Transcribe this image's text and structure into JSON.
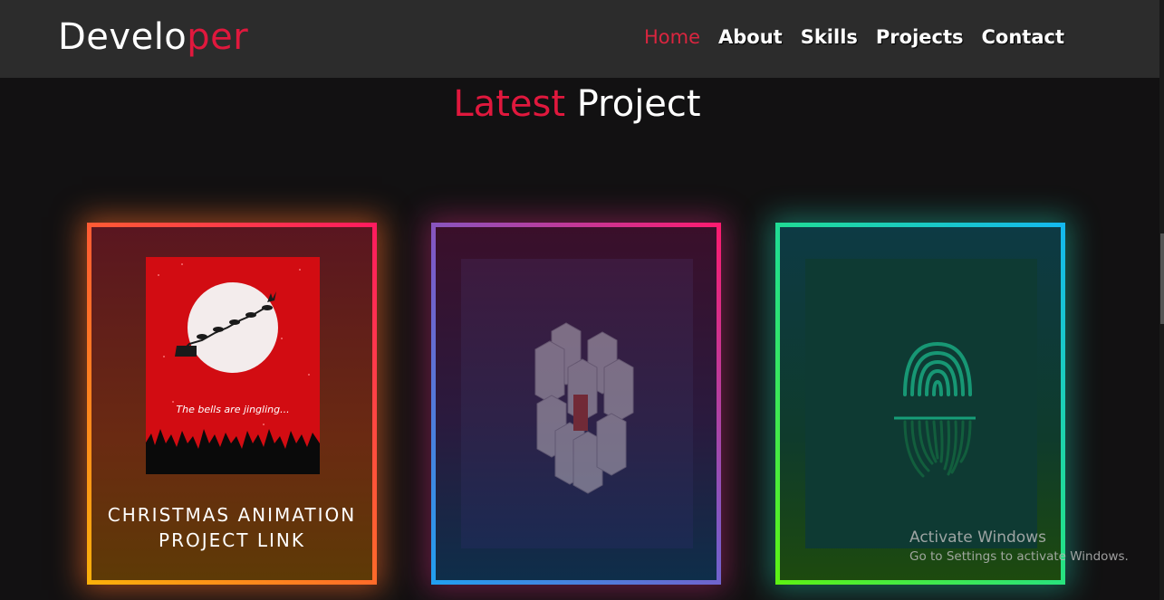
{
  "header": {
    "logo_main": "Develo",
    "logo_accent": "per",
    "nav": [
      "Home",
      "About",
      "Skills",
      "Projects",
      "Contact"
    ],
    "active_nav": "Home"
  },
  "section": {
    "title_accent": "Latest",
    "title_rest": " Project"
  },
  "projects": [
    {
      "thumbnail_caption": "The bells are jingling...",
      "title_line1": "CHRISTMAS ANIMATION",
      "title_line2": "PROJECT LINK"
    },
    {},
    {}
  ],
  "watermark": {
    "title": "Activate Windows",
    "subtitle": "Go to Settings to activate Windows."
  },
  "colors": {
    "accent": "#e0183d",
    "background": "#121112",
    "navbar": "#2c2c2c"
  }
}
